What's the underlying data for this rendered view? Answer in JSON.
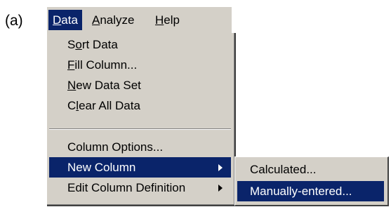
{
  "figure_label": "(a)",
  "menubar": {
    "items": [
      {
        "pre": "",
        "key": "D",
        "post": "ata"
      },
      {
        "pre": "",
        "key": "A",
        "post": "nalyze"
      },
      {
        "pre": "",
        "key": "H",
        "post": "elp"
      }
    ],
    "active_index": 0
  },
  "data_menu": {
    "items": [
      {
        "pre": "S",
        "key": "o",
        "post": "rt Data"
      },
      {
        "pre": "",
        "key": "F",
        "post": "ill Column..."
      },
      {
        "pre": "",
        "key": "N",
        "post": "ew Data Set"
      },
      {
        "pre": "C",
        "key": "l",
        "post": "ear All Data"
      },
      {
        "pre": "Column Options...",
        "key": "",
        "post": ""
      },
      {
        "pre": "New Column",
        "key": "",
        "post": ""
      },
      {
        "pre": "Edit Column Definition",
        "key": "",
        "post": ""
      }
    ],
    "highlighted_index": 5
  },
  "new_column_submenu": {
    "items": [
      {
        "label": "Calculated..."
      },
      {
        "label": "Manually-entered..."
      }
    ],
    "highlighted_index": 1
  }
}
